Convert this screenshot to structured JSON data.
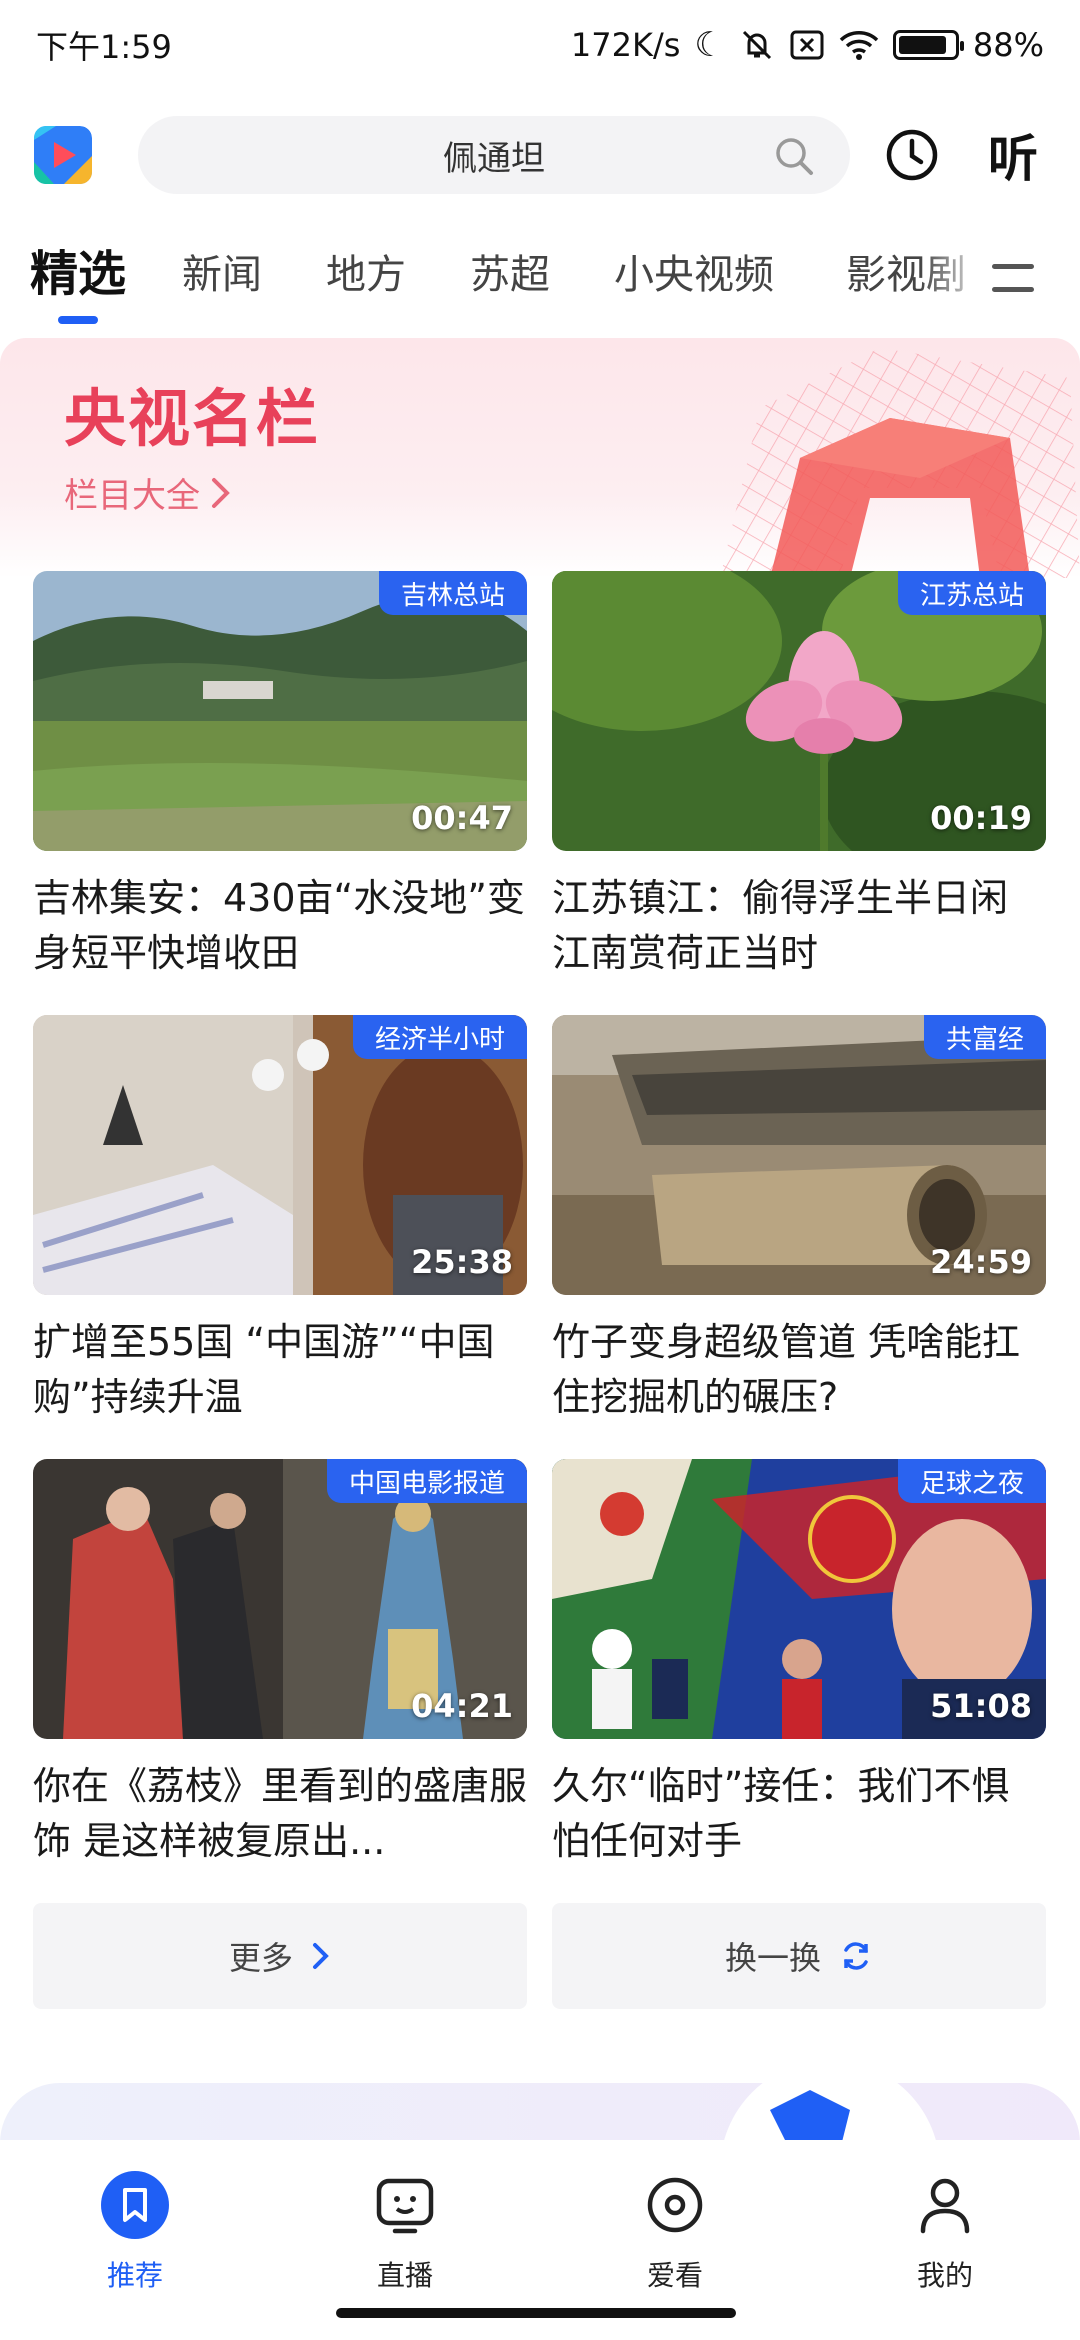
{
  "status_bar": {
    "time": "下午1:59",
    "network_speed": "172K/s",
    "battery_percent": "88%",
    "battery_level": 0.88,
    "icons": [
      "moon-icon",
      "bell-off-icon",
      "sim-off-icon",
      "wifi-icon",
      "battery-icon"
    ]
  },
  "header": {
    "search_text": "佩通坦",
    "listen_label": "听",
    "icons": [
      "app-logo",
      "search-icon",
      "history-icon"
    ]
  },
  "tabs": [
    {
      "label": "精选",
      "active": true
    },
    {
      "label": "新闻"
    },
    {
      "label": "地方"
    },
    {
      "label": "苏超"
    },
    {
      "label": "小央视频"
    },
    {
      "label": "影视剧"
    }
  ],
  "banner": {
    "title": "央视名栏",
    "link_label": "栏目大全",
    "link_icon": "chevron-right-icon"
  },
  "videos": [
    {
      "badge": "吉林总站",
      "duration": "00:47",
      "title": "吉林集安：430亩“水没地”变身短平快增收田"
    },
    {
      "badge": "江苏总站",
      "duration": "00:19",
      "title": "江苏镇江：偷得浮生半日闲 江南赏荷正当时"
    },
    {
      "badge": "经济半小时",
      "duration": "25:38",
      "title": "扩增至55国 “中国游”“中国购”持续升温"
    },
    {
      "badge": "共富经",
      "duration": "24:59",
      "title": "竹子变身超级管道 凭啥能扛住挖掘机的碾压?"
    },
    {
      "badge": "中国电影报道",
      "duration": "04:21",
      "title": "你在《荔枝》里看到的盛唐服饰 是这样被复原出..."
    },
    {
      "badge": "足球之夜",
      "duration": "51:08",
      "title": "久尔“临时”接任：我们不惧怕任何对手"
    }
  ],
  "actions": {
    "more_label": "更多",
    "refresh_label": "换一换"
  },
  "bottom_nav": [
    {
      "label": "推荐",
      "icon": "bookmark-icon",
      "active": true
    },
    {
      "label": "直播",
      "icon": "tv-icon"
    },
    {
      "label": "爱看",
      "icon": "disc-icon"
    },
    {
      "label": "我的",
      "icon": "person-icon"
    }
  ],
  "colors": {
    "accent": "#1f5ff5",
    "badge": "#2a63f0",
    "banner_title": "#e8415a"
  }
}
